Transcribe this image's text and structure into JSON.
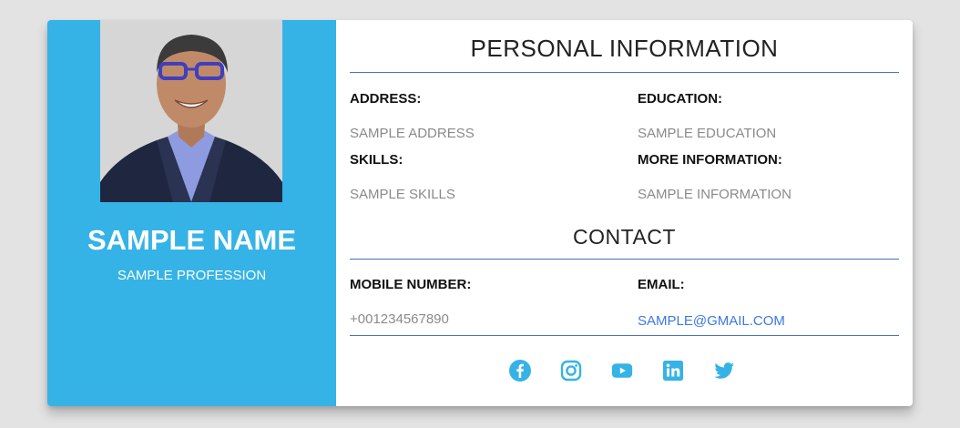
{
  "profile": {
    "name": "SAMPLE NAME",
    "profession": "SAMPLE PROFESSION"
  },
  "personal": {
    "title": "PERSONAL INFORMATION",
    "address_label": "ADDRESS:",
    "address_value": "SAMPLE ADDRESS",
    "education_label": "EDUCATION:",
    "education_value": "SAMPLE EDUCATION",
    "skills_label": "SKILLS:",
    "skills_value": "SAMPLE SKILLS",
    "more_label": "MORE INFORMATION:",
    "more_value": "SAMPLE INFORMATION"
  },
  "contact": {
    "title": "CONTACT",
    "mobile_label": "MOBILE NUMBER:",
    "mobile_value": "+001234567890",
    "email_label": "EMAIL:",
    "email_value": "SAMPLE@GMAIL.COM"
  },
  "socials": [
    "facebook-icon",
    "instagram-icon",
    "youtube-icon",
    "linkedin-icon",
    "twitter-icon"
  ],
  "colors": {
    "accent": "#35b3e6",
    "rule": "#4a6fc1",
    "link": "#3b78e6"
  }
}
